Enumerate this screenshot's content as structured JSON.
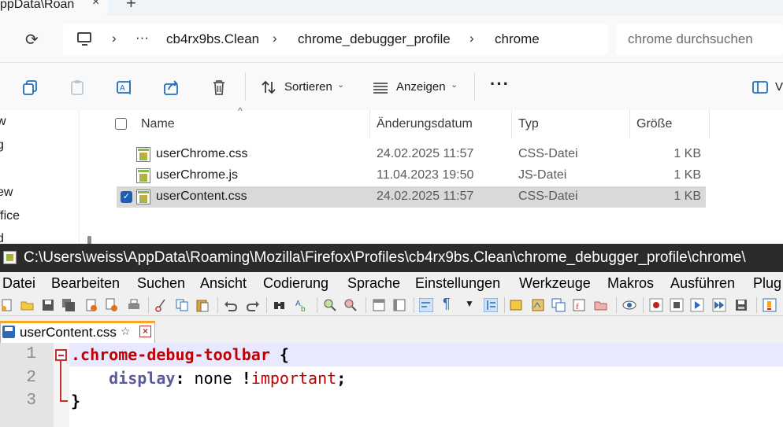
{
  "explorer": {
    "tab_title": "ppData\\Roan",
    "address": {
      "ellipsis": "···",
      "crumbs": [
        "cb4rx9bs.Clean",
        "chrome_debugger_profile",
        "chrome"
      ]
    },
    "search_placeholder": "chrome durchsuchen",
    "command_bar": {
      "sort_label": "Sortieren",
      "view_label": "Anzeigen",
      "more_label": "···",
      "right_label": "V"
    },
    "nav_fragments": [
      "w",
      "g",
      "ew",
      "ffice",
      "d"
    ],
    "columns": {
      "name": "Name",
      "date": "Änderungsdatum",
      "type": "Typ",
      "size": "Größe"
    },
    "files": [
      {
        "name": "userChrome.css",
        "date": "24.02.2025 11:57",
        "type": "CSS-Datei",
        "size": "1 KB",
        "selected": false
      },
      {
        "name": "userChrome.js",
        "date": "11.04.2023 19:50",
        "type": "JS-Datei",
        "size": "1 KB",
        "selected": false
      },
      {
        "name": "userContent.css",
        "date": "24.02.2025 11:57",
        "type": "CSS-Datei",
        "size": "1 KB",
        "selected": true
      }
    ]
  },
  "notepad": {
    "title": "C:\\Users\\weiss\\AppData\\Roaming\\Mozilla\\Firefox\\Profiles\\cb4rx9bs.Clean\\chrome_debugger_profile\\chrome\\",
    "menu": [
      "Datei",
      "Bearbeiten",
      "Suchen",
      "Ansicht",
      "Codierung",
      "Sprache",
      "Einstellungen",
      "Werkzeuge",
      "Makros",
      "Ausführen",
      "Plug"
    ],
    "tab": {
      "label": "userContent.css",
      "pin": "☆",
      "close": "×"
    },
    "line_numbers": [
      "1",
      "2",
      "3"
    ],
    "code": {
      "selector": ".chrome-debug-toolbar",
      "open_brace": " {",
      "indent": "    ",
      "property": "display",
      "colon": ":",
      "value": " none ",
      "bang": "!",
      "important": "important",
      "semicolon": ";",
      "close_brace": "}"
    }
  },
  "colors": {
    "accent_tab": "#f5a623",
    "keyword_red": "#c00000",
    "property_purple": "#5a5a9c",
    "selection_row": "#d9d9d9",
    "checkbox_blue": "#1d5fb8"
  }
}
